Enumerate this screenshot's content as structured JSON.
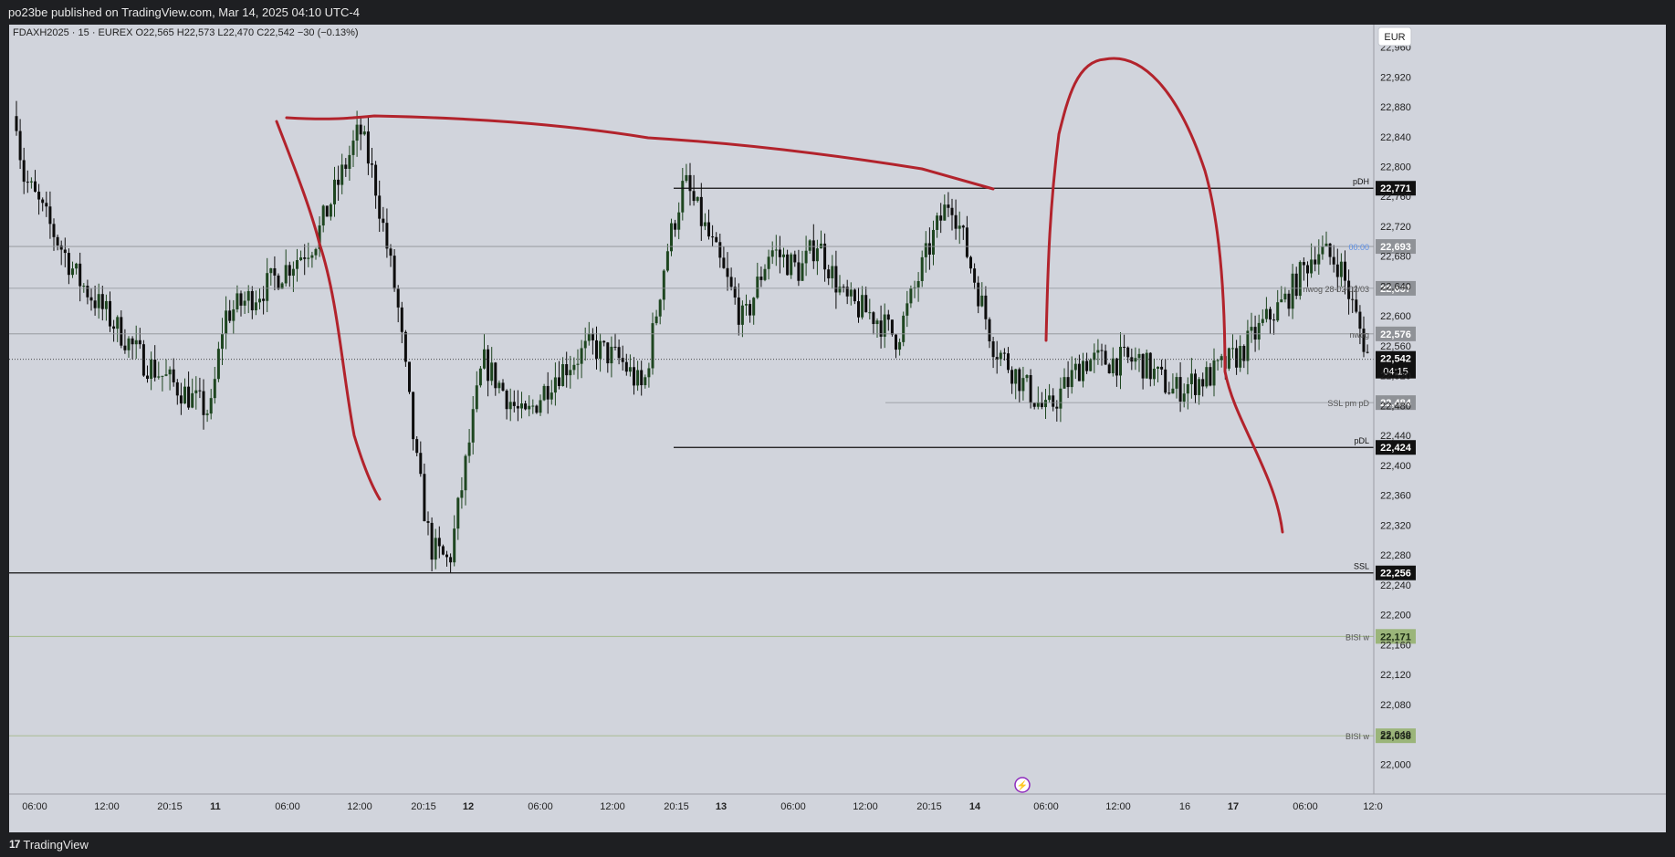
{
  "header": {
    "publisher_line": "po23be published on TradingView.com, Mar 14, 2025 04:10 UTC-4"
  },
  "legend": {
    "symbol_line": "FDAXH2025 · 15 · EUREX  O22,565  H22,573  L22,470  C22,542  −30 (−0.13%)"
  },
  "currency_badge": "EUR",
  "footer": {
    "brand": "TradingView",
    "logo_glyph": "17"
  },
  "colors": {
    "background": "#d1d4dc",
    "bull": "#1e4620",
    "bear": "#0d0d0d",
    "drawing": "#b2232c",
    "bisi": "#9bb57a",
    "grey_line": "#8f9297",
    "blue_tag": "#5b8ee6"
  },
  "chart_data": {
    "type": "candlestick",
    "title": "FDAXH2025 · 15 · EUREX",
    "ylim": [
      21960,
      22990
    ],
    "y_ticks": [
      22960,
      22920,
      22880,
      22840,
      22800,
      22760,
      22720,
      22680,
      22640,
      22600,
      22560,
      22520,
      22480,
      22440,
      22400,
      22360,
      22320,
      22280,
      22240,
      22200,
      22160,
      22120,
      22080,
      22040,
      22000
    ],
    "x_tick_labels": [
      "06:00",
      "12:00",
      "20:15",
      "11",
      "06:00",
      "12:00",
      "20:15",
      "12",
      "06:00",
      "12:00",
      "20:15",
      "13",
      "06:00",
      "12:00",
      "20:15",
      "14",
      "06:00",
      "12:00",
      "16",
      "17",
      "06:00",
      "12:0"
    ],
    "session_anchors": [
      {
        "label": "start",
        "price": 22960
      },
      {
        "label": "10-06:00",
        "price": 22790
      },
      {
        "label": "10-12:00",
        "price": 22650
      },
      {
        "label": "10-15:00",
        "price": 22540
      },
      {
        "label": "10-18:00",
        "price": 22470
      },
      {
        "label": "10-20:15",
        "price": 22600
      },
      {
        "label": "10-23:00",
        "price": 22640
      },
      {
        "label": "11-02:00",
        "price": 22700
      },
      {
        "label": "11-05:00",
        "price": 22850
      },
      {
        "label": "11-06:00",
        "price": 22780
      },
      {
        "label": "11-08:00",
        "price": 22620
      },
      {
        "label": "11-10:00",
        "price": 22410
      },
      {
        "label": "11-11:30",
        "price": 22290
      },
      {
        "label": "11-13:00",
        "price": 22270
      },
      {
        "label": "11-15:00",
        "price": 22540
      },
      {
        "label": "11-18:00",
        "price": 22460
      },
      {
        "label": "11-20:15",
        "price": 22520
      },
      {
        "label": "11-23:00",
        "price": 22560
      },
      {
        "label": "12-01:00",
        "price": 22540
      },
      {
        "label": "12-03:00",
        "price": 22500
      },
      {
        "label": "12-05:00",
        "price": 22680
      },
      {
        "label": "12-06:30",
        "price": 22780
      },
      {
        "label": "12-09:00",
        "price": 22700
      },
      {
        "label": "12-12:00",
        "price": 22590
      },
      {
        "label": "12-14:00",
        "price": 22690
      },
      {
        "label": "12-18:00",
        "price": 22660
      },
      {
        "label": "12-20:15",
        "price": 22700
      },
      {
        "label": "12-23:00",
        "price": 22620
      },
      {
        "label": "13-02:00",
        "price": 22600
      },
      {
        "label": "13-04:00",
        "price": 22570
      },
      {
        "label": "13-05:30",
        "price": 22710
      },
      {
        "label": "13-06:30",
        "price": 22760
      },
      {
        "label": "13-08:00",
        "price": 22560
      },
      {
        "label": "13-09:30",
        "price": 22470
      },
      {
        "label": "13-11:00",
        "price": 22540
      },
      {
        "label": "13-14:00",
        "price": 22540
      },
      {
        "label": "13-16:00",
        "price": 22500
      },
      {
        "label": "13-18:00",
        "price": 22520
      },
      {
        "label": "13-20:15",
        "price": 22550
      },
      {
        "label": "13-22:00",
        "price": 22600
      },
      {
        "label": "13-23:30",
        "price": 22620
      },
      {
        "label": "14-01:00",
        "price": 22690
      },
      {
        "label": "14-02:30",
        "price": 22670
      },
      {
        "label": "14-04:10",
        "price": 22542
      }
    ],
    "last": {
      "price": 22542,
      "countdown": "04:15"
    },
    "levels": [
      {
        "name": "pDH",
        "price": 22771,
        "value_label": "22,771",
        "tag": "pDH",
        "style": "black"
      },
      {
        "name": "00:00",
        "price": 22693,
        "value_label": "22,693",
        "tag": "00:00",
        "style": "grey"
      },
      {
        "name": "nwog 28-02-02/03",
        "price": 22637,
        "value_label": "22,637",
        "tag": "nwog 28-02-02/03",
        "style": "grey"
      },
      {
        "name": "nwog",
        "price": 22576,
        "value_label": "22,576",
        "tag": "nwog",
        "style": "grey"
      },
      {
        "name": "SSL pm pD",
        "price": 22484,
        "value_label": "22,484",
        "tag": "SSL pm pD",
        "style": "grey"
      },
      {
        "name": "pDL",
        "price": 22424,
        "value_label": "22,424",
        "tag": "pDL",
        "style": "black"
      },
      {
        "name": "SSL",
        "price": 22256,
        "value_label": "22,256",
        "tag": "SSL",
        "style": "black"
      },
      {
        "name": "BISI w",
        "price": 22171,
        "value_label": "22,171",
        "tag": "BISI w",
        "style": "green"
      },
      {
        "name": "BISI w",
        "price": 22038,
        "value_label": "22,038",
        "tag": "BISI w",
        "style": "green"
      }
    ],
    "last_value_label": "22,542"
  }
}
